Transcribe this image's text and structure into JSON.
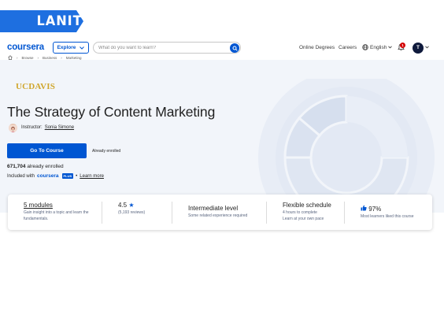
{
  "brand": {
    "lanit": "LANIT",
    "coursera": "coursera"
  },
  "nav": {
    "explore": "Explore",
    "search_placeholder": "What do you want to learn?",
    "online_degrees": "Online Degrees",
    "careers": "Careers",
    "language": "English",
    "notifications": "1",
    "avatar_initial": "T"
  },
  "breadcrumb": [
    "Browse",
    "Business",
    "Marketing"
  ],
  "partner": "UCDAVIS",
  "course": {
    "title": "The Strategy of Content Marketing",
    "instructor_label": "Instructor:",
    "instructor_name": "Sonia Simone",
    "cta": "Go To Course",
    "enrolled_note": "Already enrolled",
    "enrolled_count": "671,704",
    "enrolled_suffix": "already enrolled",
    "included_prefix": "Included with",
    "plus": "PLUS",
    "learn_more": "Learn more"
  },
  "stats": [
    {
      "title": "5 modules",
      "sub": "Gain insight into a topic and learn the fundamentals."
    },
    {
      "title": "4.5",
      "sub": "(5,193 reviews)"
    },
    {
      "title": "Intermediate level",
      "sub": "Some related experience required"
    },
    {
      "title": "Flexible schedule",
      "sub1": "4 hours to complete",
      "sub2": "Learn at your own pace"
    },
    {
      "title": "97%",
      "sub": "Most learners liked this course"
    }
  ],
  "colors": {
    "primary": "#0056d2",
    "lanit": "#1e6fe0",
    "ucdavis": "#d0a62c",
    "hero_bg": "#f2f5fa"
  }
}
